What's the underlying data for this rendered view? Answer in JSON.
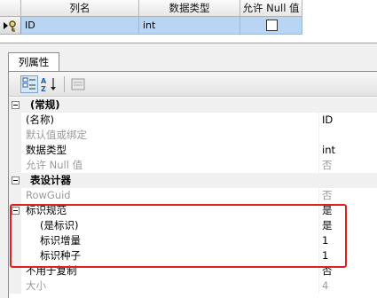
{
  "grid": {
    "headers": {
      "name": "列名",
      "type": "数据类型",
      "allow_null": "允许 Null 值"
    },
    "row": {
      "name": "ID",
      "type": "int",
      "allow_null_checked": false
    }
  },
  "panel": {
    "tab_label": "列属性",
    "toolbar": [
      "categorized-icon",
      "sort-az-icon",
      "property-pages-icon"
    ],
    "rows": [
      {
        "kind": "category",
        "name": "(常规)",
        "value": ""
      },
      {
        "kind": "prop",
        "name": "(名称)",
        "value": "ID",
        "disabled": false
      },
      {
        "kind": "prop",
        "name": "默认值或绑定",
        "value": "",
        "disabled": true
      },
      {
        "kind": "prop",
        "name": "数据类型",
        "value": "int",
        "disabled": false
      },
      {
        "kind": "prop",
        "name": "允许 Null 值",
        "value": "否",
        "disabled": true
      },
      {
        "kind": "category",
        "name": "表设计器",
        "value": ""
      },
      {
        "kind": "prop",
        "name": "RowGuid",
        "value": "否",
        "disabled": true
      },
      {
        "kind": "group",
        "name": "标识规范",
        "value": "是"
      },
      {
        "kind": "sub",
        "name": "(是标识)",
        "value": "是"
      },
      {
        "kind": "sub",
        "name": "标识增量",
        "value": "1"
      },
      {
        "kind": "sub",
        "name": "标识种子",
        "value": "1"
      },
      {
        "kind": "prop",
        "name": "不用于复制",
        "value": "否",
        "disabled": false
      },
      {
        "kind": "prop",
        "name": "大小",
        "value": "4",
        "disabled": true
      }
    ]
  },
  "colors": {
    "selection": "#b8d6f3",
    "highlight_border": "#e0201c",
    "disabled_text": "#9a9a9a"
  }
}
